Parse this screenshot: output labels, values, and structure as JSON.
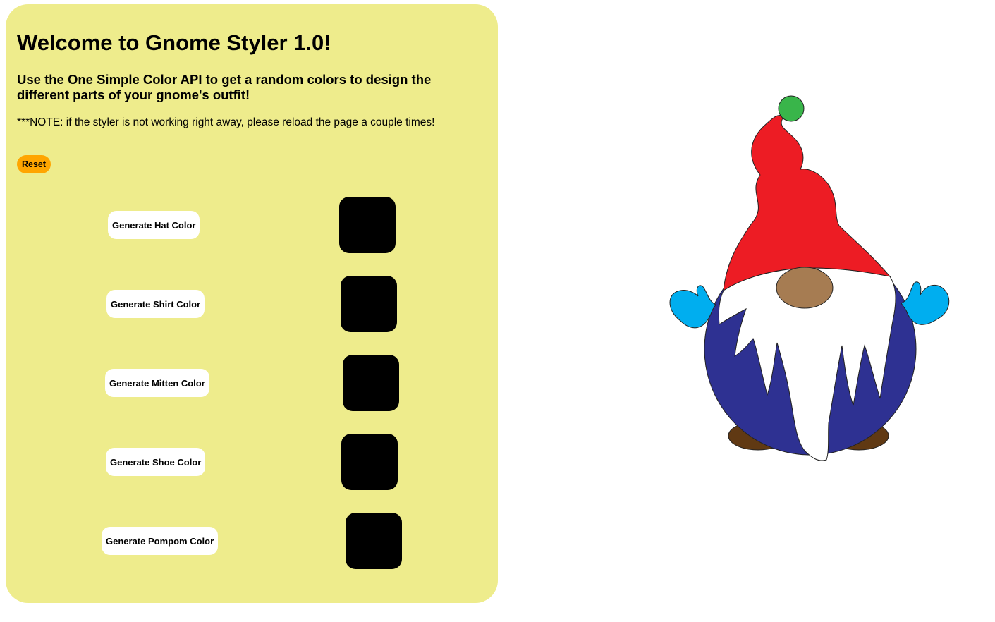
{
  "header": {
    "title": "Welcome to Gnome Styler 1.0!",
    "subtitle": "Use the One Simple Color API to get a random colors to design the different parts of your gnome's outfit!",
    "note": "***NOTE: if the styler is not working right away, please reload the page a couple times!"
  },
  "controls": {
    "reset_label": "Reset",
    "hat_label": "Generate Hat Color",
    "shirt_label": "Generate Shirt Color",
    "mitten_label": "Generate Mitten Color",
    "shoe_label": "Generate Shoe Color",
    "pompom_label": "Generate Pompom Color"
  },
  "swatches": {
    "hat": "#000000",
    "shirt": "#000000",
    "mitten": "#000000",
    "shoe": "#000000",
    "pompom": "#000000"
  },
  "gnome_colors": {
    "hat": "#ed1c24",
    "pompom": "#39b54a",
    "shirt": "#2e3192",
    "mittens": "#00aeef",
    "shoes": "#603913",
    "nose": "#a67c52",
    "beard": "#ffffff"
  }
}
